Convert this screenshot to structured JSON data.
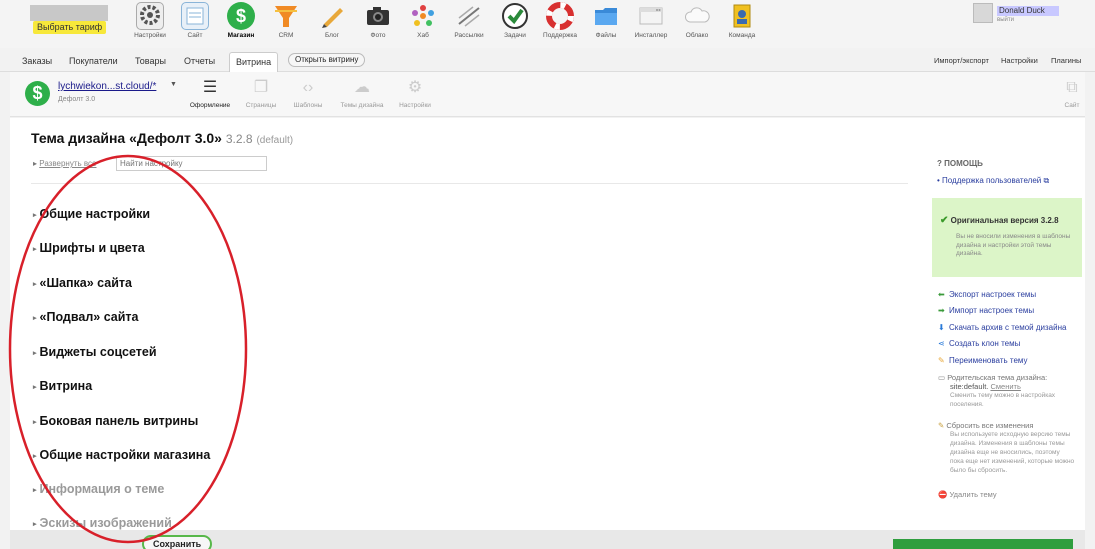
{
  "topbar": {
    "tariff_label": "Выбрать тариф",
    "apps": [
      {
        "label": "Настройки",
        "icon": "gear-icon",
        "color": "#5a5a5a"
      },
      {
        "label": "Сайт",
        "icon": "site-icon",
        "color": "#8ab4d8"
      },
      {
        "label": "Магазин",
        "icon": "dollar-icon",
        "color": "#2eaf4a"
      },
      {
        "label": "CRM",
        "icon": "crm-funnel-icon",
        "color": "#f08a24"
      },
      {
        "label": "Блог",
        "icon": "pencil-icon",
        "color": "#e8a83a"
      },
      {
        "label": "Фото",
        "icon": "camera-icon",
        "color": "#333333"
      },
      {
        "label": "Хаб",
        "icon": "hub-icon",
        "color": "#b060c0"
      },
      {
        "label": "Рассылки",
        "icon": "mailer-icon",
        "color": "#777777"
      },
      {
        "label": "Задачи",
        "icon": "checkmark-icon",
        "color": "#2a8a3a"
      },
      {
        "label": "Поддержка",
        "icon": "lifebuoy-icon",
        "color": "#d83030"
      },
      {
        "label": "Файлы",
        "icon": "folder-icon",
        "color": "#3a8ad8"
      },
      {
        "label": "Инсталлер",
        "icon": "installer-icon",
        "color": "#cccccc"
      },
      {
        "label": "Облако",
        "icon": "cloud-icon",
        "color": "#dddddd"
      },
      {
        "label": "Команда",
        "icon": "team-icon",
        "color": "#f0c020"
      }
    ],
    "user_name": "Donald Duck",
    "logout": "выйти"
  },
  "tabs": [
    "Заказы",
    "Покупатели",
    "Товары",
    "Отчеты",
    "Витрина"
  ],
  "open_storefront": "Открыть витрину",
  "right_links": [
    "Импорт/экспорт",
    "Настройки",
    "Плагины"
  ],
  "toolbar": {
    "site_url": "lychwiekon...st.cloud/*",
    "theme_name": "Дефолт 3.0",
    "items": [
      "Оформление",
      "Страницы",
      "Шаблоны",
      "Темы дизайна",
      "Настройки"
    ],
    "site_label": "Сайт"
  },
  "main": {
    "title": "Тема дизайна «Дефолт 3.0»",
    "version": "3.2.8",
    "default_tag": "(default)",
    "expand_all": "Развернуть все",
    "search_placeholder": "Найти настройку",
    "sections": [
      "Общие настройки",
      "Шрифты и цвета",
      "«Шапка» сайта",
      "«Подвал» сайта",
      "Виджеты соцсетей",
      "Витрина",
      "Боковая панель витрины",
      "Общие настройки магазина",
      "Информация о теме",
      "Эскизы изображений"
    ]
  },
  "sidebar": {
    "help_title": "ПОМОЩЬ",
    "help_link": "Поддержка пользователей",
    "original_title": "Оригинальная версия 3.2.8",
    "original_text": "Вы не вносили изменения в шаблоны дизайна и настройки этой темы дизайна.",
    "actions": [
      "Экспорт настроек темы",
      "Импорт настроек темы",
      "Скачать архив с темой дизайна",
      "Создать клон темы",
      "Переименовать тему"
    ],
    "parent_theme_label": "Родительская тема дизайна:",
    "parent_theme_value": "site:default.",
    "parent_change": "Сменить",
    "parent_note": "Сменить тему можно в настройках поселения.",
    "reset_title": "Сбросить все изменения",
    "reset_text": "Вы используете исходную версию темы дизайна. Изменения в шаблоны темы дизайна еще не вносились, поэтому пока еще нет изменений, которые можно было бы сбросить.",
    "delete_theme": "Удалить тему"
  },
  "footer": {
    "save": "Сохранить"
  },
  "annotation_color": "#d8202a"
}
